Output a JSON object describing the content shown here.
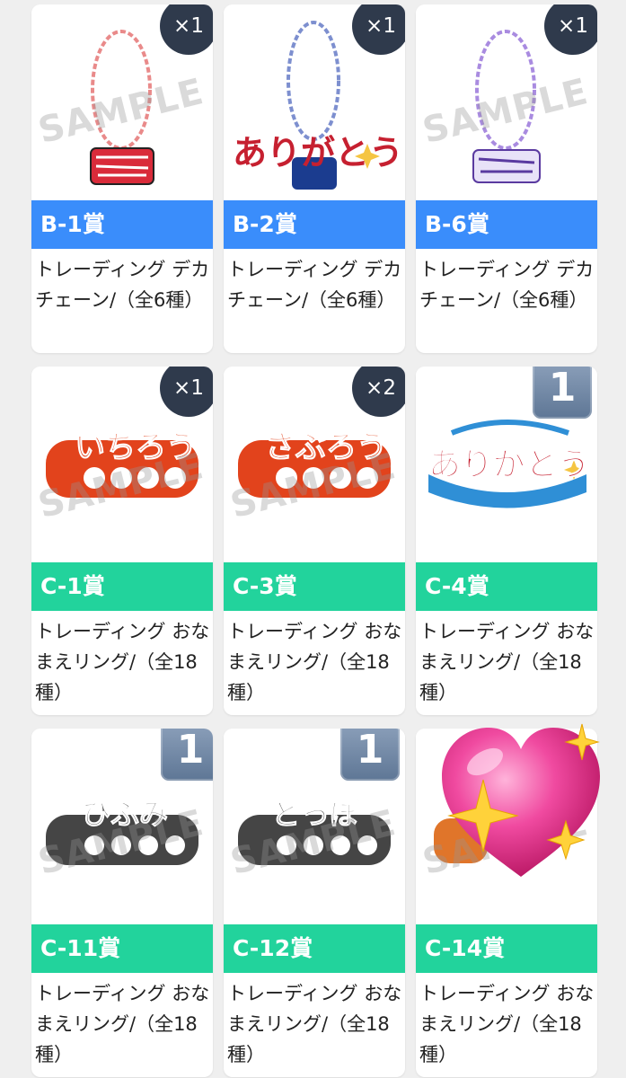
{
  "cards": [
    {
      "prize": "B-1賞",
      "name": "トレーディング デカチェーン/（全6種）",
      "qty": "×1",
      "qty_style": "circle",
      "band_color": "#3a8dfb",
      "watermark": "SAMPLE"
    },
    {
      "prize": "B-2賞",
      "name": "トレーディング デカチェーン/（全6種）",
      "qty": "×1",
      "qty_style": "circle",
      "band_color": "#3a8dfb",
      "watermark": "",
      "thumb_text": "ありがとう"
    },
    {
      "prize": "B-6賞",
      "name": "トレーディング デカチェーン/（全6種）",
      "qty": "×1",
      "qty_style": "circle",
      "band_color": "#3a8dfb",
      "watermark": "SAMPLE"
    },
    {
      "prize": "C-1賞",
      "name": "トレーディング おなまえリング/（全18種）",
      "qty": "×1",
      "qty_style": "circle",
      "band_color": "#22d39c",
      "watermark": "SAMPLE",
      "thumb_text": "いちろう"
    },
    {
      "prize": "C-3賞",
      "name": "トレーディング おなまえリング/（全18種）",
      "qty": "×2",
      "qty_style": "circle",
      "band_color": "#22d39c",
      "watermark": "SAMPLE",
      "thumb_text": "さぶろう"
    },
    {
      "prize": "C-4賞",
      "name": "トレーディング おなまえリング/（全18種）",
      "qty": "1",
      "qty_style": "square",
      "band_color": "#22d39c",
      "watermark": "",
      "thumb_text": "ありがとう"
    },
    {
      "prize": "C-11賞",
      "name": "トレーディング おなまえリング/（全18種）",
      "qty": "1",
      "qty_style": "square",
      "band_color": "#22d39c",
      "watermark": "SAMPLE",
      "thumb_text": "ひふみ"
    },
    {
      "prize": "C-12賞",
      "name": "トレーディング おなまえリング/（全18種）",
      "qty": "1",
      "qty_style": "square",
      "band_color": "#22d39c",
      "watermark": "SAMPLE",
      "thumb_text": "どっぽ"
    },
    {
      "prize": "C-14賞",
      "name": "トレーディング おなまえリング/（全18種）",
      "qty": "",
      "qty_style": "none",
      "band_color": "#22d39c",
      "watermark": "SAMPLE"
    }
  ],
  "overlay": {
    "icon": "sparkling-heart-icon",
    "color": "#f04aa0"
  }
}
